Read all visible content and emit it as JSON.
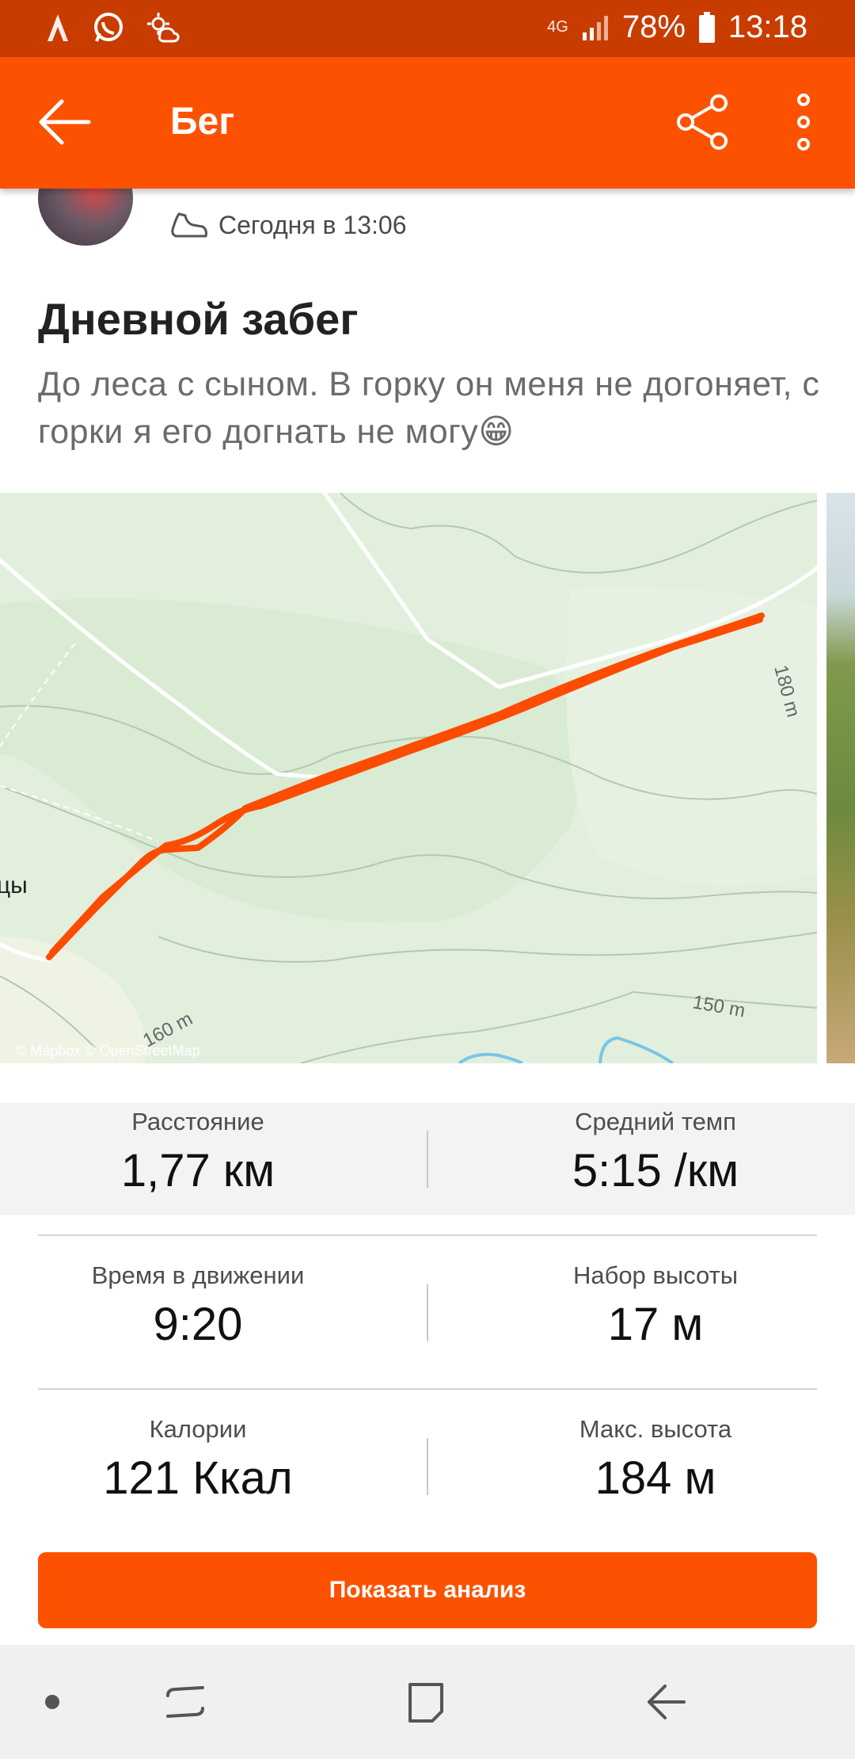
{
  "status_bar": {
    "network": "4G",
    "battery": "78%",
    "time": "13:18"
  },
  "app_bar": {
    "title": "Бег"
  },
  "activity": {
    "time_label": "Сегодня в 13:06",
    "title": "Дневной забег",
    "description": "До леса с сыном. В горку он меня не догоняет, с горки я его догнать не могу😁"
  },
  "map": {
    "elevation_label_1": "180 m",
    "elevation_label_2": "150 m",
    "elevation_label_3": "160 m",
    "place_label": "цы",
    "attribution": "© Mapbox © OpenStreetMap",
    "route_color": "#fc4c02"
  },
  "stats": {
    "distance_label": "Расстояние",
    "distance_value": "1,77 км",
    "pace_label": "Средний темп",
    "pace_value": "5:15 /км",
    "moving_time_label": "Время в движении",
    "moving_time_value": "9:20",
    "elevation_gain_label": "Набор высоты",
    "elevation_gain_value": "17 м",
    "calories_label": "Калории",
    "calories_value": "121 Ккал",
    "max_elevation_label": "Макс. высота",
    "max_elevation_value": "184 м"
  },
  "actions": {
    "analysis_button": "Показать анализ"
  },
  "colors": {
    "brand_orange": "#fc5200",
    "status_bar": "#c93c00"
  }
}
